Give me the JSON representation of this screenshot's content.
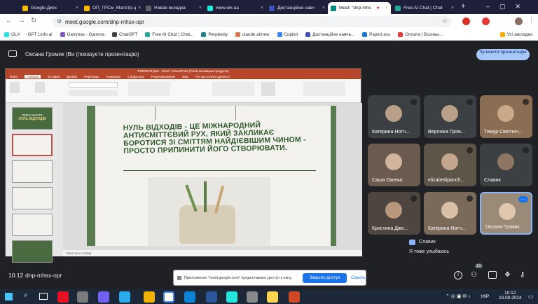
{
  "tabs": [
    {
      "label": "Google Диск",
      "color": "#fbbc04"
    },
    {
      "label": "ОП_ГРСм_Магістр.ц",
      "color": "#fbbc04"
    },
    {
      "label": "Новая вкладка",
      "color": "#5f6368"
    },
    {
      "label": "www.olx.ua",
      "color": "#23e5db"
    },
    {
      "label": "Дистанційне навч",
      "color": "#3f51b5"
    },
    {
      "label": "Meet: \"dnp-mhs",
      "color": "#00897b"
    },
    {
      "label": "Free AI Chat | Chat",
      "color": "#26a69a"
    }
  ],
  "url": "meet.google.com/dnp-mhsx-opr",
  "bookmarks": [
    "OLX",
    "GPT Linfo.ai",
    "Gammas - Gamma",
    "ChatGPT",
    "Free AI Chat | Chat...",
    "Perplexity",
    "claude.ai/new",
    "Copilot",
    "Дистанційне навча...",
    "PaperLess",
    "Оплата | Всілиьк...",
    "Усі закладки"
  ],
  "presenter_label": "Оксана Громик (Ви (показуєте презентацію)",
  "stop_button": "Зупинити презентацію",
  "ppt": {
    "title": "PRESENT.pptx - Word - PowerPoint (Сбой активации продукта)",
    "tabs": [
      "Файл",
      "Главная",
      "Вставка",
      "Дизайн",
      "Переходы",
      "Анимация",
      "Слайд-шоу",
      "Рецензирование",
      "Вид",
      "Что вы хотите сделать?"
    ],
    "thumb1_title": "ZERO WASTE",
    "thumb1_sub": "НУЛЬ ВІДХОДІВ",
    "slide_text": "Нуль відходів - це міжнародний антисміттєвий рух, який закликає боротися зі сміттям найдієвішим чином - просто припинити його створювати.",
    "notes": "Заметки к слайду"
  },
  "participants": [
    {
      "name": "Катерина Нотч...",
      "bg": "#3c4043"
    },
    {
      "name": "Вероніка Гром...",
      "bg": "#3c4043"
    },
    {
      "name": "Тимур Светлич...",
      "bg": "#8a6d52"
    },
    {
      "name": "Саша Ожема",
      "bg": "#6b5a4e"
    },
    {
      "name": "elizabetlipanch...",
      "bg": "#5d5648"
    },
    {
      "name": "Славик",
      "bg": "#3c4043"
    },
    {
      "name": "Кристина Дже...",
      "bg": "#4d4640"
    },
    {
      "name": "Катерина Нотч...",
      "bg": "#7a6a5a"
    },
    {
      "name": "Оксана Громик",
      "bg": "#9a8a78"
    }
  ],
  "chat": {
    "sender": "Славик",
    "message": "Я тоже улыбаюсь"
  },
  "meeting": {
    "time": "10:12",
    "code": "dnp-mhsx-opr",
    "participant_count": "10"
  },
  "share_notice": {
    "text": "Приложение \"meet.google.com\" предоставило доступ к окну.",
    "stop_label": "Закрыть доступ",
    "hide_label": "Скрыть"
  },
  "taskbar": {
    "lang": "УКР",
    "time": "10:12",
    "date": "23.09.2024"
  }
}
